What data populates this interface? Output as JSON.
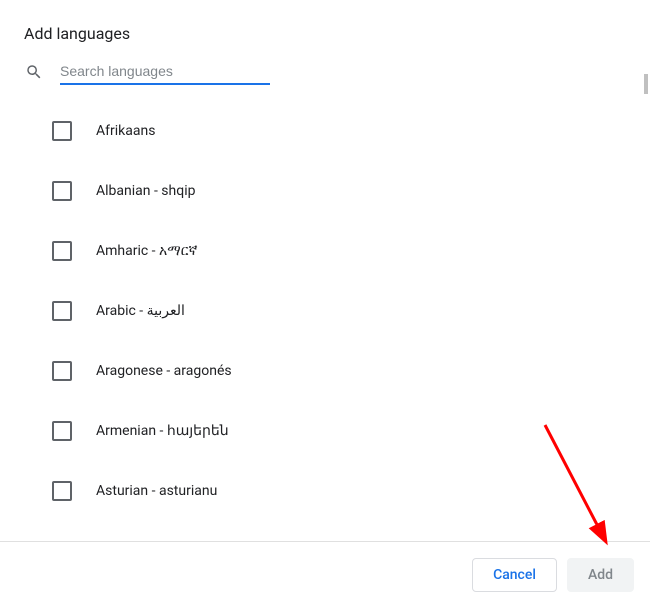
{
  "dialog": {
    "title": "Add languages"
  },
  "search": {
    "placeholder": "Search languages",
    "value": ""
  },
  "languages": [
    {
      "label": "Afrikaans"
    },
    {
      "label": "Albanian - shqip"
    },
    {
      "label": "Amharic - አማርኛ"
    },
    {
      "label": "Arabic - العربية"
    },
    {
      "label": "Aragonese - aragonés"
    },
    {
      "label": "Armenian - հայերեն"
    },
    {
      "label": "Asturian - asturianu"
    }
  ],
  "footer": {
    "cancel": "Cancel",
    "add": "Add"
  }
}
